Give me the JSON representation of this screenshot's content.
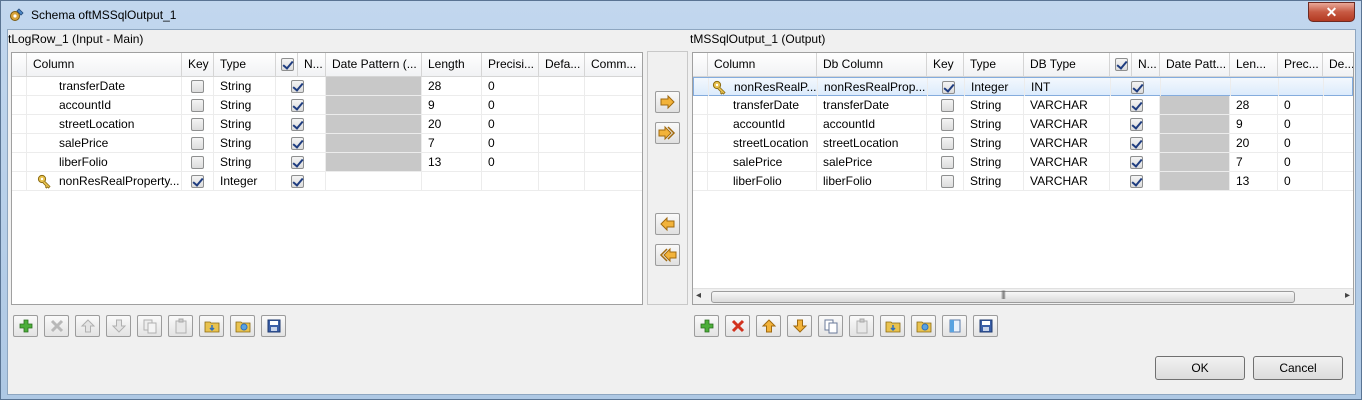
{
  "window": {
    "title": "Schema oftMSSqlOutput_1",
    "close_label": "✕"
  },
  "left": {
    "label": "tLogRow_1 (Input - Main)",
    "headers": [
      "Column",
      "Key",
      "Type",
      "",
      "N...",
      "Date Pattern (...",
      "Length",
      "Precisi...",
      "Defa...",
      "Comm..."
    ],
    "rows": [
      {
        "column": "transferDate",
        "key": false,
        "type": "String",
        "nullable": true,
        "length": "28",
        "precision": "0",
        "has_key_icon": false
      },
      {
        "column": "accountId",
        "key": false,
        "type": "String",
        "nullable": true,
        "length": "9",
        "precision": "0",
        "has_key_icon": false
      },
      {
        "column": "streetLocation",
        "key": false,
        "type": "String",
        "nullable": true,
        "length": "20",
        "precision": "0",
        "has_key_icon": false
      },
      {
        "column": "salePrice",
        "key": false,
        "type": "String",
        "nullable": true,
        "length": "7",
        "precision": "0",
        "has_key_icon": false
      },
      {
        "column": "liberFolio",
        "key": false,
        "type": "String",
        "nullable": true,
        "length": "13",
        "precision": "0",
        "has_key_icon": false
      },
      {
        "column": "nonResRealProperty...",
        "key": true,
        "type": "Integer",
        "nullable": true,
        "length": "",
        "precision": "",
        "has_key_icon": true
      }
    ]
  },
  "right": {
    "label": "tMSSqlOutput_1 (Output)",
    "headers": [
      "Column",
      "Db Column",
      "Key",
      "Type",
      "DB Type",
      "",
      "N...",
      "Date Patt...",
      "Len...",
      "Prec...",
      "De..."
    ],
    "rows": [
      {
        "column": "nonResRealP...",
        "db_column": "nonResRealProp...",
        "key": true,
        "type": "Integer",
        "db_type": "INT",
        "nullable": true,
        "length": "",
        "precision": "",
        "has_key_icon": true,
        "selected": true
      },
      {
        "column": "transferDate",
        "db_column": "transferDate",
        "key": false,
        "type": "String",
        "db_type": "VARCHAR",
        "nullable": true,
        "length": "28",
        "precision": "0",
        "has_key_icon": false,
        "selected": false
      },
      {
        "column": "accountId",
        "db_column": "accountId",
        "key": false,
        "type": "String",
        "db_type": "VARCHAR",
        "nullable": true,
        "length": "9",
        "precision": "0",
        "has_key_icon": false,
        "selected": false
      },
      {
        "column": "streetLocation",
        "db_column": "streetLocation",
        "key": false,
        "type": "String",
        "db_type": "VARCHAR",
        "nullable": true,
        "length": "20",
        "precision": "0",
        "has_key_icon": false,
        "selected": false
      },
      {
        "column": "salePrice",
        "db_column": "salePrice",
        "key": false,
        "type": "String",
        "db_type": "VARCHAR",
        "nullable": true,
        "length": "7",
        "precision": "0",
        "has_key_icon": false,
        "selected": false
      },
      {
        "column": "liberFolio",
        "db_column": "liberFolio",
        "key": false,
        "type": "String",
        "db_type": "VARCHAR",
        "nullable": true,
        "length": "13",
        "precision": "0",
        "has_key_icon": false,
        "selected": false
      }
    ],
    "scroll_grip": "|||"
  },
  "buttons": {
    "ok": "OK",
    "cancel": "Cancel"
  },
  "colors": {
    "accent": "#84acdd",
    "add_green": "#3a9a2a",
    "delete_red": "#cc2a1a",
    "arrow_orange": "#e8a21a"
  }
}
